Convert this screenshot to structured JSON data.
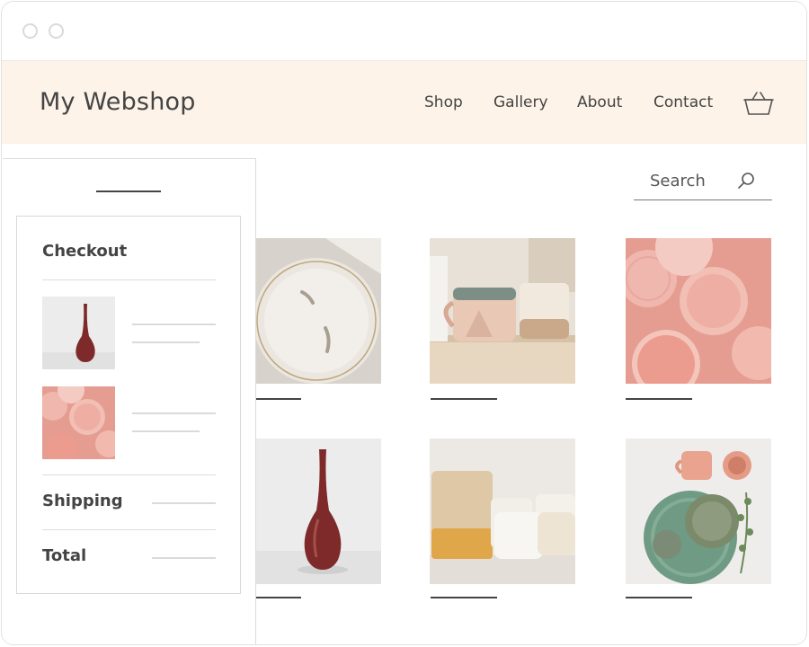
{
  "brand": "My Webshop",
  "nav": [
    "Shop",
    "Gallery",
    "About",
    "Contact"
  ],
  "search": {
    "label": "Search"
  },
  "checkout": {
    "title": "Checkout",
    "shipping": "Shipping",
    "total": "Total"
  },
  "icons": {
    "cart": "basket-icon",
    "search": "search-icon"
  },
  "colors": {
    "header_bg": "#fdf3e8",
    "text": "#444444",
    "accent_pink": "#e59c91",
    "accent_green": "#6f9a84"
  },
  "gallery": [
    "plate-tile",
    "mugs-tile",
    "pink-dishes-tile",
    "vase-tile",
    "cups-tile",
    "green-plates-tile"
  ]
}
